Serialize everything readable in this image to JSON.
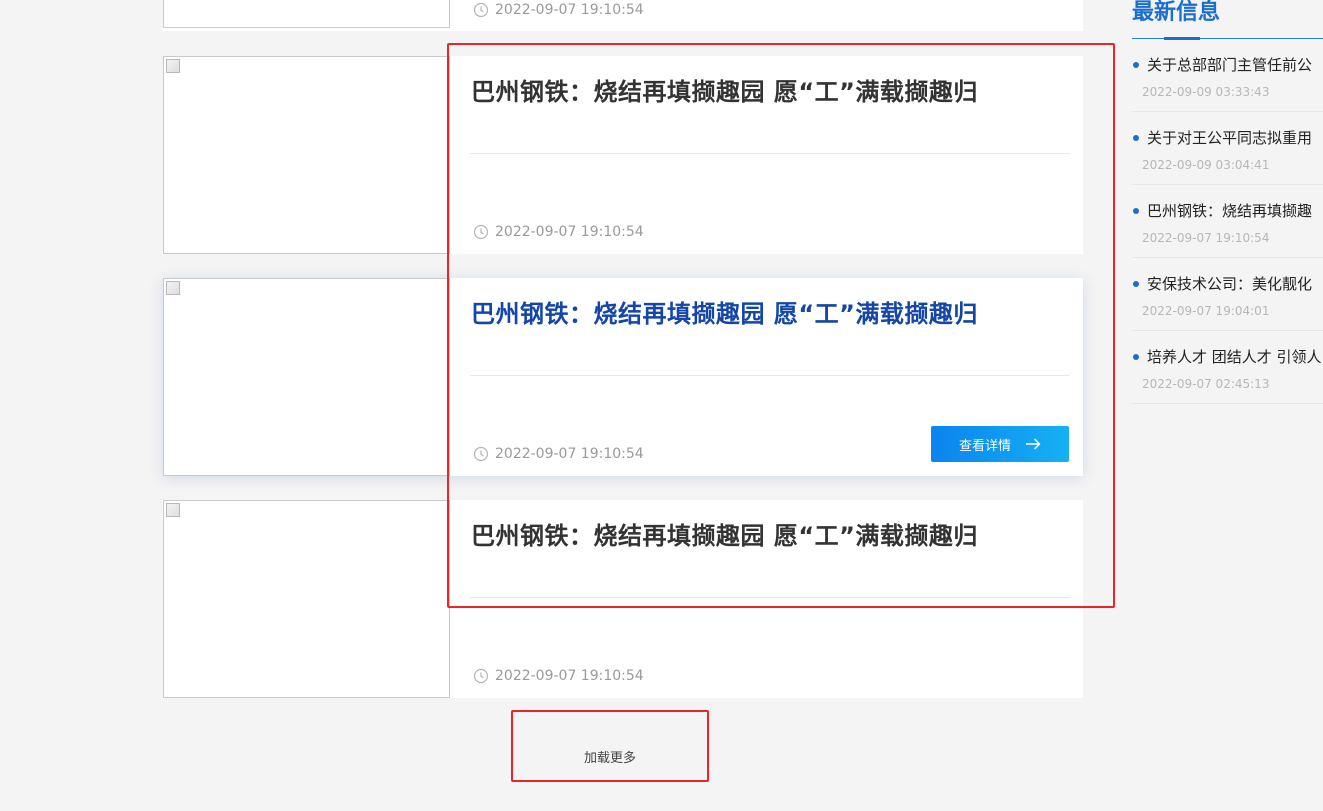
{
  "articles": [
    {
      "title": "",
      "time": "2022-09-07 19:10:54"
    },
    {
      "title": "巴州钢铁：烧结再填撷趣园 愿“工”满载撷趣归",
      "time": "2022-09-07 19:10:54"
    },
    {
      "title": "巴州钢铁：烧结再填撷趣园 愿“工”满载撷趣归",
      "time": "2022-09-07 19:10:54",
      "detail_label": "查看详情"
    },
    {
      "title": "巴州钢铁：烧结再填撷趣园 愿“工”满载撷趣归",
      "time": "2022-09-07 19:10:54"
    }
  ],
  "load_more_label": "加载更多",
  "sidebar": {
    "title": "最新信息",
    "items": [
      {
        "title": "关于总部部门主管任前公",
        "time": "2022-09-09 03:33:43"
      },
      {
        "title": "关于对王公平同志拟重用",
        "time": "2022-09-09 03:04:41"
      },
      {
        "title": "巴州钢铁：烧结再填撷趣",
        "time": "2022-09-07 19:10:54"
      },
      {
        "title": "安保技术公司：美化靓化",
        "time": "2022-09-07 19:04:01"
      },
      {
        "title": "培养人才 团结人才 引领人",
        "time": "2022-09-07 02:45:13"
      }
    ]
  },
  "colors": {
    "accent": "#1a6ecf",
    "active_title": "#1346a8",
    "annotation": "#e8262a",
    "button_start": "#0b84ef",
    "button_end": "#16b0f3"
  },
  "icons": {
    "time": "clock-icon",
    "button": "arrow-right-icon",
    "broken_image": "broken-image-icon"
  }
}
